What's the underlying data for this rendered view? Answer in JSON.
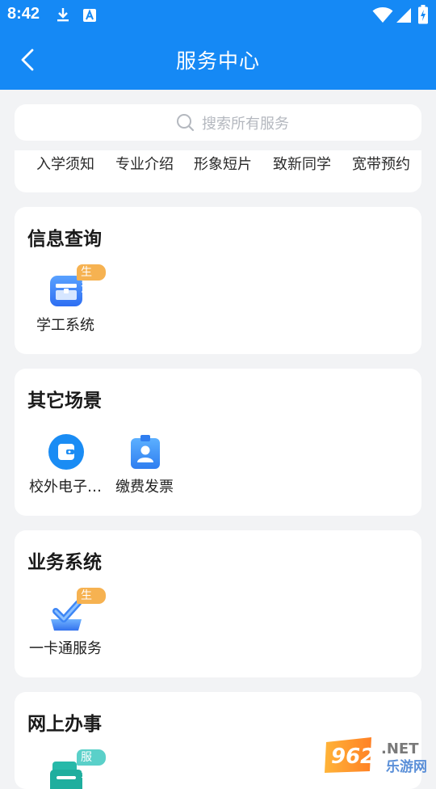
{
  "status_bar": {
    "time": "8:42"
  },
  "header": {
    "title": "服务中心"
  },
  "search": {
    "placeholder": "搜索所有服务"
  },
  "quick_links": [
    "入学须知",
    "专业介绍",
    "形象短片",
    "致新同学",
    "宽带预约"
  ],
  "sections": [
    {
      "title": "信息查询",
      "items": [
        {
          "label": "学工系统",
          "badge": "生活",
          "icon": "briefcase-icon"
        }
      ]
    },
    {
      "title": "其它场景",
      "items": [
        {
          "label": "校外电子…",
          "icon": "wallet-icon"
        },
        {
          "label": "缴费发票",
          "icon": "user-badge-icon"
        }
      ]
    },
    {
      "title": "业务系统",
      "items": [
        {
          "label": "一卡通服务",
          "badge": "生活",
          "icon": "check-card-icon"
        }
      ]
    },
    {
      "title": "网上办事",
      "items": [
        {
          "badge": "服务",
          "icon": "service-icon"
        }
      ]
    }
  ],
  "watermark": {
    "number": "962",
    "suffix": ".NET",
    "text": "乐游网"
  },
  "colors": {
    "brand": "#1589f5",
    "background": "#f2f3f5",
    "badge_orange": "#f6b251",
    "badge_teal": "#5ad0c9"
  }
}
